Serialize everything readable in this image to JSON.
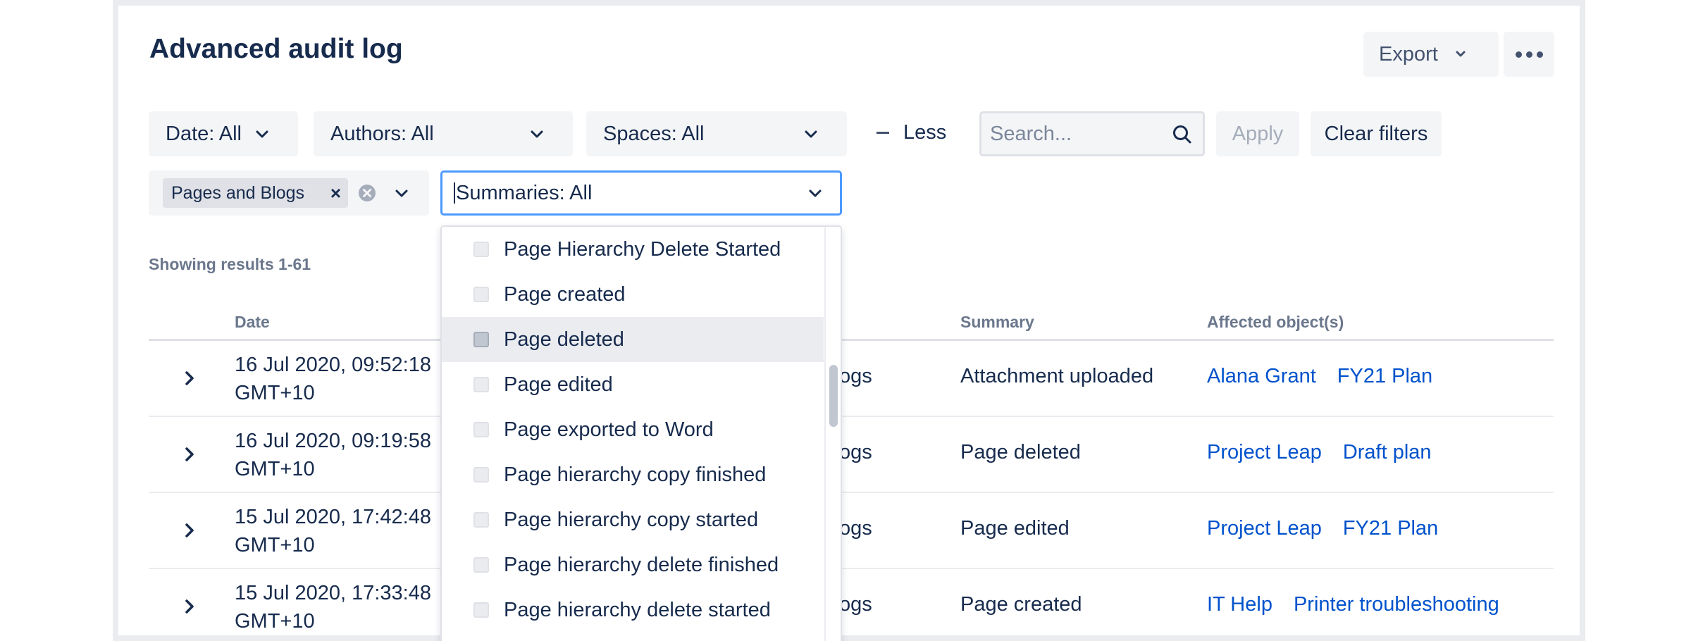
{
  "header": {
    "title": "Advanced audit log",
    "export_label": "Export",
    "more_label": "More actions"
  },
  "filters": {
    "date": "Date: All",
    "authors": "Authors: All",
    "spaces": "Spaces: All",
    "less": "Less",
    "search_placeholder": "Search...",
    "apply": "Apply",
    "clear": "Clear filters",
    "category_chip": "Pages and Blogs",
    "summaries": "Summaries: All"
  },
  "results_text": "Showing results 1-61",
  "table": {
    "columns": [
      "Date",
      "Summary",
      "Affected object(s)"
    ],
    "rows": [
      {
        "date_line1": "16 Jul 2020, 09:52:18",
        "date_line2": "GMT+10",
        "category": "ogs",
        "summary": "Attachment uploaded",
        "objects": [
          "Alana Grant",
          "FY21 Plan"
        ]
      },
      {
        "date_line1": "16 Jul 2020, 09:19:58",
        "date_line2": "GMT+10",
        "category": "ogs",
        "summary": "Page deleted",
        "objects": [
          "Project Leap",
          "Draft plan"
        ]
      },
      {
        "date_line1": "15 Jul 2020, 17:42:48",
        "date_line2": "GMT+10",
        "category": "ogs",
        "summary": "Page edited",
        "objects": [
          "Project Leap",
          "FY21 Plan"
        ]
      },
      {
        "date_line1": "15 Jul 2020, 17:33:48",
        "date_line2": "GMT+10",
        "category": "ogs",
        "summary": "Page created",
        "objects": [
          "IT Help",
          "Printer troubleshooting"
        ]
      }
    ]
  },
  "dropdown": {
    "options": [
      "Page Hierarchy Delete Started",
      "Page created",
      "Page deleted",
      "Page edited",
      "Page exported to Word",
      "Page hierarchy copy finished",
      "Page hierarchy copy started",
      "Page hierarchy delete finished",
      "Page hierarchy delete started"
    ],
    "hovered": "Page deleted"
  },
  "colors": {
    "text": "#172B4D",
    "link": "#0052CC",
    "focus": "#4C9AFF",
    "muted": "#6B778C",
    "button_bg": "#F4F5F7"
  }
}
